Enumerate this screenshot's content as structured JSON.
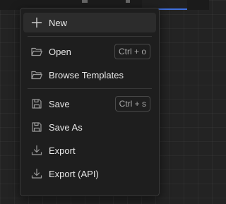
{
  "menu": {
    "items": [
      {
        "label": "New",
        "icon": "plus-icon"
      },
      {
        "label": "Open",
        "icon": "folder-open-icon",
        "shortcut": "Ctrl + o"
      },
      {
        "label": "Browse Templates",
        "icon": "folder-open-icon"
      },
      {
        "label": "Save",
        "icon": "floppy-disk-icon",
        "shortcut": "Ctrl + s"
      },
      {
        "label": "Save As",
        "icon": "floppy-disk-icon"
      },
      {
        "label": "Export",
        "icon": "download-icon"
      },
      {
        "label": "Export (API)",
        "icon": "download-icon"
      }
    ]
  },
  "colors": {
    "background": "#232323",
    "menu_bg": "#1e1e1e",
    "highlight": "#2c2c2c",
    "text": "#e8e8e8",
    "accent": "#3f6fdc"
  }
}
